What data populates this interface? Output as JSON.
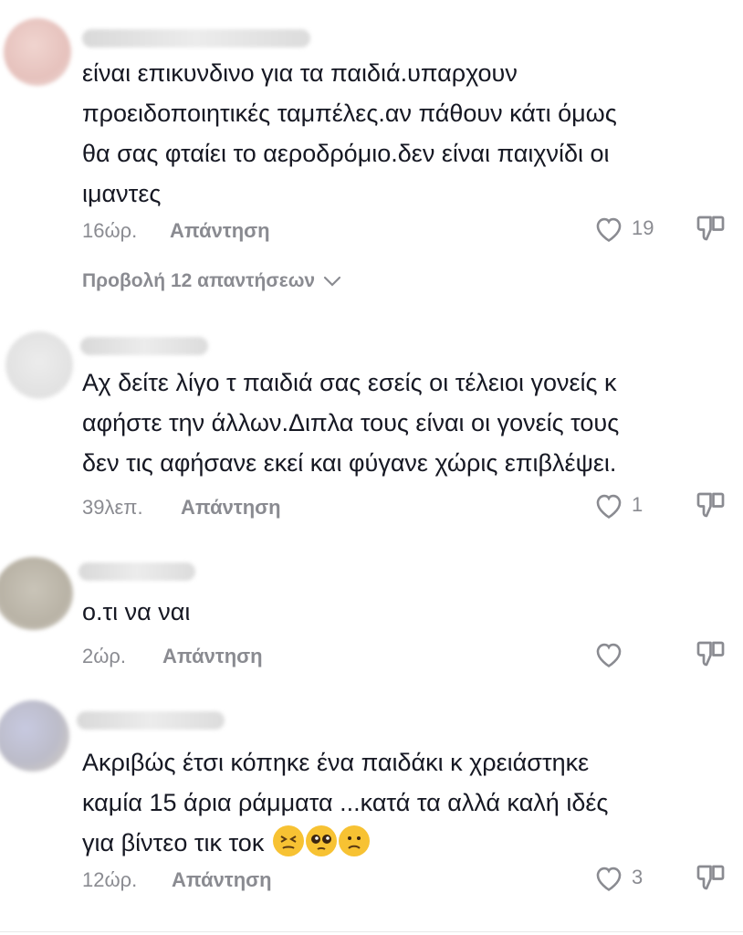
{
  "comments": [
    {
      "text": "είναι επικυνδινο για τα παιδιά.υπαρχουν\nπροειδοποιητικές ταμπέλες.αν πάθουν κάτι όμως\nθα σας φταίει το αεροδρόμιο.δεν είναι παιχνίδι οι\nιμαντες",
      "time": "16ώρ.",
      "reply": "Απάντηση",
      "likes": "19"
    },
    {
      "text": "Αχ δείτε λίγο τ παιδιά σας εσείς οι τέλειοι γονείς κ\nαφήστε την άλλων.Διπλα τους είναι οι γονείς τους\nδεν τις αφήσανε εκεί και φύγανε χώρις επιβλέψει.",
      "time": "39λεπ.",
      "reply": "Απάντηση",
      "likes": "1"
    },
    {
      "text": "ο.τι να ναι",
      "time": "2ώρ.",
      "reply": "Απάντηση",
      "likes": ""
    },
    {
      "text_main": "Ακριβώς έτσι κόπηκε ένα παιδάκι κ χρειάστηκε\nκαμία 15 άρια ράμματα ...κατά τα αλλά καλή ιδές\nγια βίντεο τικ τοκ ",
      "time": "12ώρ.",
      "reply": "Απάντηση",
      "likes": "3",
      "emojis": [
        "persevering-face",
        "pleading-face",
        "frowning-face"
      ]
    }
  ],
  "view_replies": "Προβολή 12 απαντήσεων",
  "colors": {
    "text": "#161823",
    "meta": "#8a8b91",
    "emoji": "#f7c233"
  }
}
